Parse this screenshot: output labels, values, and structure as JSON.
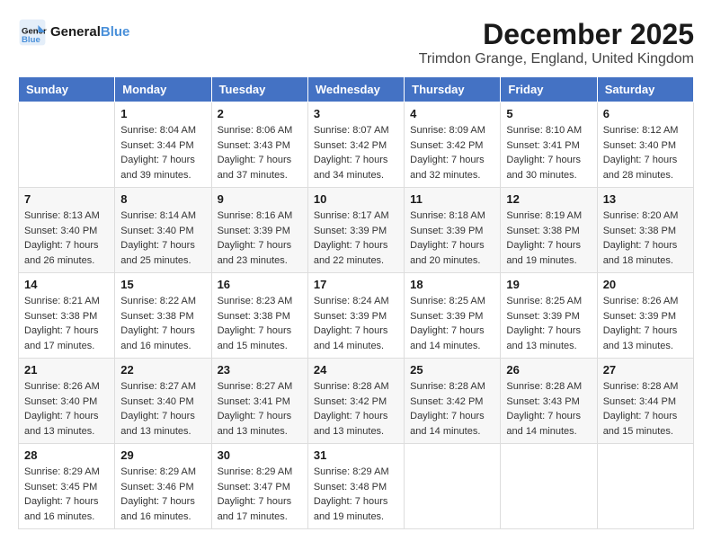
{
  "header": {
    "logo_general": "General",
    "logo_blue": "Blue",
    "month_year": "December 2025",
    "location": "Trimdon Grange, England, United Kingdom"
  },
  "days_of_week": [
    "Sunday",
    "Monday",
    "Tuesday",
    "Wednesday",
    "Thursday",
    "Friday",
    "Saturday"
  ],
  "weeks": [
    [
      {
        "day": "",
        "sunrise": "",
        "sunset": "",
        "daylight": ""
      },
      {
        "day": "1",
        "sunrise": "Sunrise: 8:04 AM",
        "sunset": "Sunset: 3:44 PM",
        "daylight": "Daylight: 7 hours and 39 minutes."
      },
      {
        "day": "2",
        "sunrise": "Sunrise: 8:06 AM",
        "sunset": "Sunset: 3:43 PM",
        "daylight": "Daylight: 7 hours and 37 minutes."
      },
      {
        "day": "3",
        "sunrise": "Sunrise: 8:07 AM",
        "sunset": "Sunset: 3:42 PM",
        "daylight": "Daylight: 7 hours and 34 minutes."
      },
      {
        "day": "4",
        "sunrise": "Sunrise: 8:09 AM",
        "sunset": "Sunset: 3:42 PM",
        "daylight": "Daylight: 7 hours and 32 minutes."
      },
      {
        "day": "5",
        "sunrise": "Sunrise: 8:10 AM",
        "sunset": "Sunset: 3:41 PM",
        "daylight": "Daylight: 7 hours and 30 minutes."
      },
      {
        "day": "6",
        "sunrise": "Sunrise: 8:12 AM",
        "sunset": "Sunset: 3:40 PM",
        "daylight": "Daylight: 7 hours and 28 minutes."
      }
    ],
    [
      {
        "day": "7",
        "sunrise": "Sunrise: 8:13 AM",
        "sunset": "Sunset: 3:40 PM",
        "daylight": "Daylight: 7 hours and 26 minutes."
      },
      {
        "day": "8",
        "sunrise": "Sunrise: 8:14 AM",
        "sunset": "Sunset: 3:40 PM",
        "daylight": "Daylight: 7 hours and 25 minutes."
      },
      {
        "day": "9",
        "sunrise": "Sunrise: 8:16 AM",
        "sunset": "Sunset: 3:39 PM",
        "daylight": "Daylight: 7 hours and 23 minutes."
      },
      {
        "day": "10",
        "sunrise": "Sunrise: 8:17 AM",
        "sunset": "Sunset: 3:39 PM",
        "daylight": "Daylight: 7 hours and 22 minutes."
      },
      {
        "day": "11",
        "sunrise": "Sunrise: 8:18 AM",
        "sunset": "Sunset: 3:39 PM",
        "daylight": "Daylight: 7 hours and 20 minutes."
      },
      {
        "day": "12",
        "sunrise": "Sunrise: 8:19 AM",
        "sunset": "Sunset: 3:38 PM",
        "daylight": "Daylight: 7 hours and 19 minutes."
      },
      {
        "day": "13",
        "sunrise": "Sunrise: 8:20 AM",
        "sunset": "Sunset: 3:38 PM",
        "daylight": "Daylight: 7 hours and 18 minutes."
      }
    ],
    [
      {
        "day": "14",
        "sunrise": "Sunrise: 8:21 AM",
        "sunset": "Sunset: 3:38 PM",
        "daylight": "Daylight: 7 hours and 17 minutes."
      },
      {
        "day": "15",
        "sunrise": "Sunrise: 8:22 AM",
        "sunset": "Sunset: 3:38 PM",
        "daylight": "Daylight: 7 hours and 16 minutes."
      },
      {
        "day": "16",
        "sunrise": "Sunrise: 8:23 AM",
        "sunset": "Sunset: 3:38 PM",
        "daylight": "Daylight: 7 hours and 15 minutes."
      },
      {
        "day": "17",
        "sunrise": "Sunrise: 8:24 AM",
        "sunset": "Sunset: 3:39 PM",
        "daylight": "Daylight: 7 hours and 14 minutes."
      },
      {
        "day": "18",
        "sunrise": "Sunrise: 8:25 AM",
        "sunset": "Sunset: 3:39 PM",
        "daylight": "Daylight: 7 hours and 14 minutes."
      },
      {
        "day": "19",
        "sunrise": "Sunrise: 8:25 AM",
        "sunset": "Sunset: 3:39 PM",
        "daylight": "Daylight: 7 hours and 13 minutes."
      },
      {
        "day": "20",
        "sunrise": "Sunrise: 8:26 AM",
        "sunset": "Sunset: 3:39 PM",
        "daylight": "Daylight: 7 hours and 13 minutes."
      }
    ],
    [
      {
        "day": "21",
        "sunrise": "Sunrise: 8:26 AM",
        "sunset": "Sunset: 3:40 PM",
        "daylight": "Daylight: 7 hours and 13 minutes."
      },
      {
        "day": "22",
        "sunrise": "Sunrise: 8:27 AM",
        "sunset": "Sunset: 3:40 PM",
        "daylight": "Daylight: 7 hours and 13 minutes."
      },
      {
        "day": "23",
        "sunrise": "Sunrise: 8:27 AM",
        "sunset": "Sunset: 3:41 PM",
        "daylight": "Daylight: 7 hours and 13 minutes."
      },
      {
        "day": "24",
        "sunrise": "Sunrise: 8:28 AM",
        "sunset": "Sunset: 3:42 PM",
        "daylight": "Daylight: 7 hours and 13 minutes."
      },
      {
        "day": "25",
        "sunrise": "Sunrise: 8:28 AM",
        "sunset": "Sunset: 3:42 PM",
        "daylight": "Daylight: 7 hours and 14 minutes."
      },
      {
        "day": "26",
        "sunrise": "Sunrise: 8:28 AM",
        "sunset": "Sunset: 3:43 PM",
        "daylight": "Daylight: 7 hours and 14 minutes."
      },
      {
        "day": "27",
        "sunrise": "Sunrise: 8:28 AM",
        "sunset": "Sunset: 3:44 PM",
        "daylight": "Daylight: 7 hours and 15 minutes."
      }
    ],
    [
      {
        "day": "28",
        "sunrise": "Sunrise: 8:29 AM",
        "sunset": "Sunset: 3:45 PM",
        "daylight": "Daylight: 7 hours and 16 minutes."
      },
      {
        "day": "29",
        "sunrise": "Sunrise: 8:29 AM",
        "sunset": "Sunset: 3:46 PM",
        "daylight": "Daylight: 7 hours and 16 minutes."
      },
      {
        "day": "30",
        "sunrise": "Sunrise: 8:29 AM",
        "sunset": "Sunset: 3:47 PM",
        "daylight": "Daylight: 7 hours and 17 minutes."
      },
      {
        "day": "31",
        "sunrise": "Sunrise: 8:29 AM",
        "sunset": "Sunset: 3:48 PM",
        "daylight": "Daylight: 7 hours and 19 minutes."
      },
      {
        "day": "",
        "sunrise": "",
        "sunset": "",
        "daylight": ""
      },
      {
        "day": "",
        "sunrise": "",
        "sunset": "",
        "daylight": ""
      },
      {
        "day": "",
        "sunrise": "",
        "sunset": "",
        "daylight": ""
      }
    ]
  ]
}
